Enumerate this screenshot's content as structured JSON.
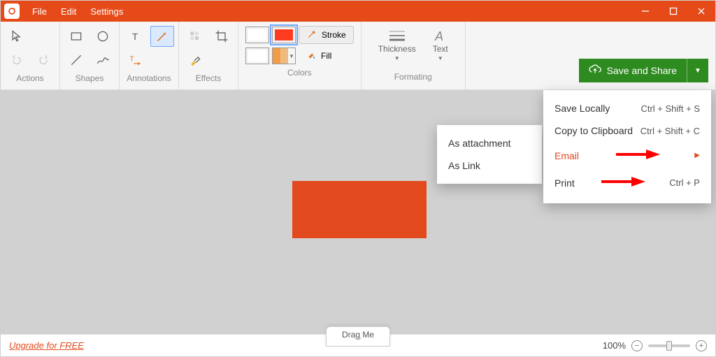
{
  "titlebar": {
    "menus": [
      "File",
      "Edit",
      "Settings"
    ]
  },
  "ribbon": {
    "groups": {
      "actions": "Actions",
      "shapes": "Shapes",
      "annotations": "Annotations",
      "effects": "Effects",
      "colors": "Colors",
      "formating": "Formating"
    },
    "colors": {
      "stroke_label": "Stroke",
      "fill_label": "Fill",
      "stroke_hex": "#ffffff",
      "fill_hex": "#ff3b1f"
    },
    "formating": {
      "thickness_label": "Thickness",
      "text_label": "Text"
    },
    "save_share": "Save and Share"
  },
  "dropdown": {
    "items": [
      {
        "label": "Save Locally",
        "shortcut": "Ctrl + Shift + S"
      },
      {
        "label": "Copy to Clipboard",
        "shortcut": "Ctrl + Shift + C"
      },
      {
        "label": "Email",
        "shortcut": "",
        "highlight": true,
        "submenu": true
      },
      {
        "label": "Print",
        "shortcut": "Ctrl + P"
      }
    ]
  },
  "submenu": {
    "items": [
      "As attachment",
      "As Link"
    ]
  },
  "canvas": {
    "shape_fill": "#e24a1e"
  },
  "footer": {
    "upgrade": "Upgrade for FREE",
    "drag": "Drag Me",
    "zoom": "100%"
  },
  "annotation_arrows": {
    "color": "#ff0000"
  }
}
